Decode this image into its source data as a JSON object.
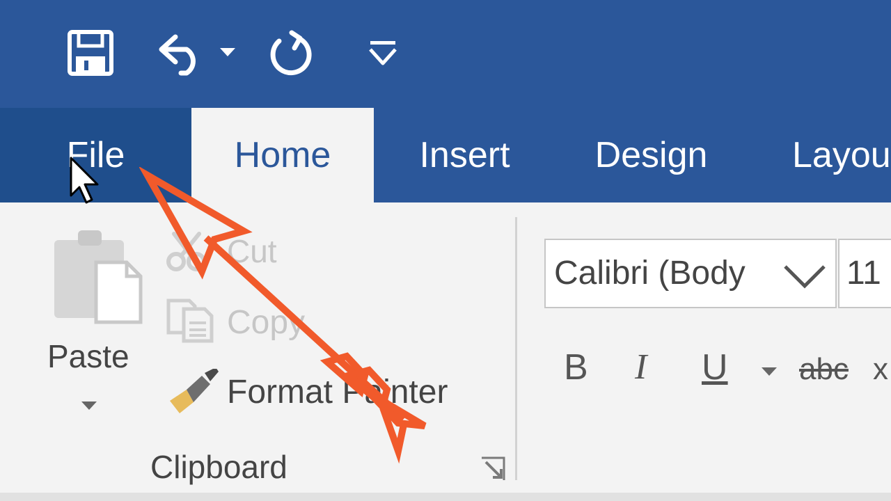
{
  "qat": {
    "save_icon": "save-icon",
    "undo_icon": "undo-icon",
    "redo_icon": "redo-icon",
    "customize_icon": "customize-qat-icon"
  },
  "tabs": {
    "file": "File",
    "home": "Home",
    "insert": "Insert",
    "design": "Design",
    "layout": "Layou"
  },
  "clipboard": {
    "paste_label": "Paste",
    "cut_label": "Cut",
    "copy_label": "Copy",
    "format_painter_label": "Format Painter",
    "group_label": "Clipboard"
  },
  "font": {
    "font_name": "Calibri (Body",
    "font_size": "11",
    "bold": "B",
    "italic": "I",
    "underline": "U",
    "strikethrough": "abc",
    "subscript_partial": "x"
  },
  "colors": {
    "titlebar": "#2b579a",
    "file_tab": "#1f4e8c",
    "ribbon_bg": "#f3f3f3",
    "annotation_arrow": "#f15a2b"
  }
}
